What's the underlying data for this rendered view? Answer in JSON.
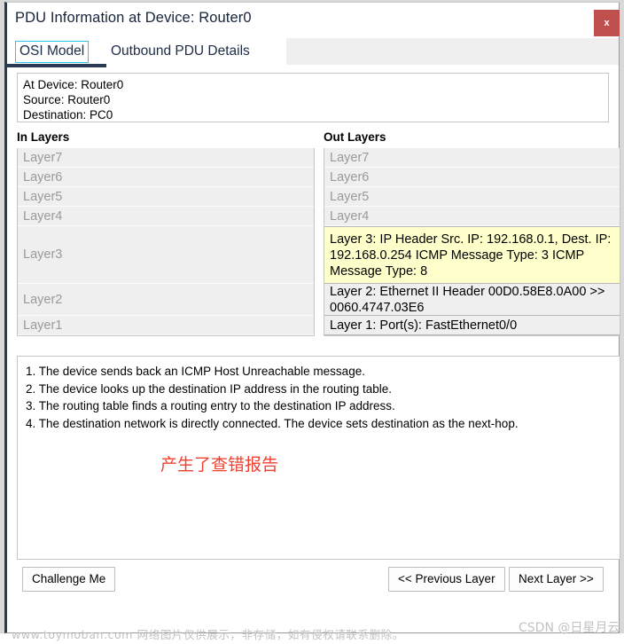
{
  "window": {
    "title": "PDU Information at Device: Router0",
    "close_label": "x",
    "accent_border": "#2b3a54",
    "close_bg": "#c0504d"
  },
  "tabs": [
    {
      "label": "OSI Model",
      "selected": true
    },
    {
      "label": "Outbound PDU Details",
      "selected": false
    }
  ],
  "info": {
    "at_device": "At Device: Router0",
    "source": "Source: Router0",
    "destination": "Destination: PC0"
  },
  "columns": {
    "in_header": "In Layers",
    "out_header": "Out Layers"
  },
  "in_layers": [
    {
      "label": "Layer7",
      "state": "empty"
    },
    {
      "label": "Layer6",
      "state": "empty"
    },
    {
      "label": "Layer5",
      "state": "empty"
    },
    {
      "label": "Layer4",
      "state": "empty"
    },
    {
      "label": "Layer3",
      "state": "empty"
    },
    {
      "label": "Layer2",
      "state": "empty"
    },
    {
      "label": "Layer1",
      "state": "empty"
    }
  ],
  "out_layers": [
    {
      "label": "Layer7",
      "state": "empty"
    },
    {
      "label": "Layer6",
      "state": "empty"
    },
    {
      "label": "Layer5",
      "state": "empty"
    },
    {
      "label": "Layer4",
      "state": "empty"
    },
    {
      "label": "Layer 3: IP Header Src. IP: 192.168.0.1, Dest. IP: 192.168.0.254 ICMP Message Type: 3 ICMP Message Type: 8",
      "state": "highlight"
    },
    {
      "label": "Layer 2: Ethernet II Header 00D0.58E8.0A00 >> 0060.4747.03E6",
      "state": "filled"
    },
    {
      "label": "Layer 1: Port(s): FastEthernet0/0",
      "state": "filled"
    }
  ],
  "highlight_color": "#ffffcc",
  "description": {
    "steps": [
      "1. The device sends back an ICMP Host Unreachable message.",
      "2. The device looks up the destination IP address in the routing table.",
      "3. The routing table finds a routing entry to the destination IP address.",
      "4. The destination network is directly connected. The device sets destination as the next-hop."
    ],
    "note": "产生了查错报告",
    "note_color": "#f04030"
  },
  "footer": {
    "challenge_label": "Challenge Me",
    "previous_label": "<< Previous Layer",
    "next_label": "Next Layer >>"
  },
  "watermarks": {
    "site": "www.toymoban.com 网络图片仅供展示，非存储，如有侵权请联系删除。",
    "csdn": "CSDN @日星月云"
  }
}
